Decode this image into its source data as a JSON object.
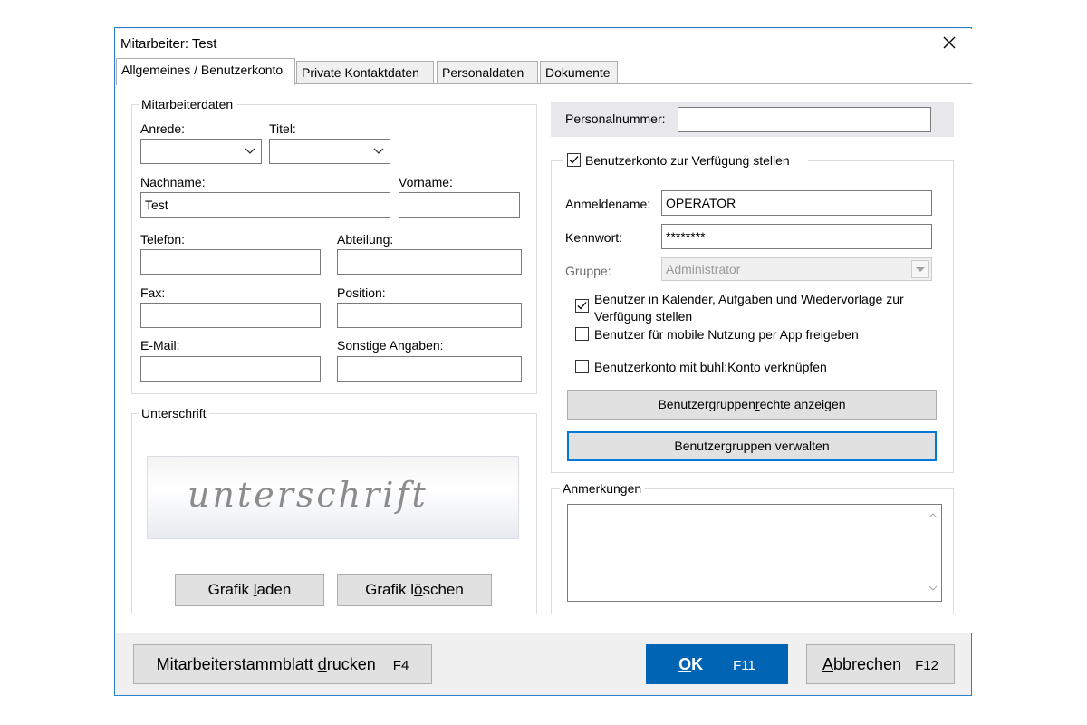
{
  "window": {
    "title": "Mitarbeiter: Test"
  },
  "tabs": [
    {
      "label": "Allgemeines / Benutzerkonto",
      "active": true
    },
    {
      "label": "Private Kontaktdaten"
    },
    {
      "label": "Personaldaten"
    },
    {
      "label": "Dokumente"
    }
  ],
  "mitarbeiterdaten": {
    "legend": "Mitarbeiterdaten",
    "anrede_label": "Anrede:",
    "anrede_value": "",
    "titel_label": "Titel:",
    "titel_value": "",
    "nachname_label": "Nachname:",
    "nachname_value": "Test",
    "vorname_label": "Vorname:",
    "vorname_value": "",
    "telefon_label": "Telefon:",
    "telefon_value": "",
    "abteilung_label": "Abteilung:",
    "abteilung_value": "",
    "fax_label": "Fax:",
    "fax_value": "",
    "position_label": "Position:",
    "position_value": "",
    "email_label": "E-Mail:",
    "email_value": "",
    "sonstige_label": "Sonstige Angaben:",
    "sonstige_value": ""
  },
  "unterschrift": {
    "legend": "Unterschrift",
    "image_text": "unterschrift",
    "grafik_laden_pre": "Grafik ",
    "grafik_laden_key": "l",
    "grafik_laden_post": "aden",
    "grafik_loeschen_pre": "Grafik l",
    "grafik_loeschen_key": "ö",
    "grafik_loeschen_post": "schen"
  },
  "personalnummer": {
    "label": "Personalnummer:",
    "value": ""
  },
  "benutzerkonto": {
    "enable_label": "Benutzerkonto zur Verfügung stellen",
    "enable_checked": true,
    "anmeldename_label": "Anmeldename:",
    "anmeldename_value": "OPERATOR",
    "kennwort_label": "Kennwort:",
    "kennwort_value": "********",
    "gruppe_label": "Gruppe:",
    "gruppe_value": "Administrator",
    "kalender_label_line1": "Benutzer in Kalender, Aufgaben und Wiedervorlage zur",
    "kalender_label_line2": "Verfügung stellen",
    "kalender_checked": true,
    "mobile_label": "Benutzer für mobile Nutzung per App freigeben",
    "mobile_checked": false,
    "buhl_label": "Benutzerkonto mit buhl:Konto verknüpfen",
    "buhl_checked": false,
    "rechte_pre": "Benutzergruppen",
    "rechte_key": "r",
    "rechte_post": "echte anzeigen",
    "verwalten_pre": "Benutzer",
    "verwalten_key": "g",
    "verwalten_post": "ruppen verwalten"
  },
  "anmerkungen": {
    "legend": "Anmerkungen",
    "value": ""
  },
  "footer": {
    "print_pre": "Mitarbeiterstammblatt ",
    "print_key": "d",
    "print_post": "rucken",
    "print_shortcut": "F4",
    "ok_key": "O",
    "ok_post": "K",
    "ok_shortcut": "F11",
    "cancel_key": "A",
    "cancel_post": "bbrechen",
    "cancel_shortcut": "F12"
  },
  "colors": {
    "accent": "#0064b4",
    "window_border": "#2a7fd0",
    "dialog_bg": "#f0f0f0"
  }
}
